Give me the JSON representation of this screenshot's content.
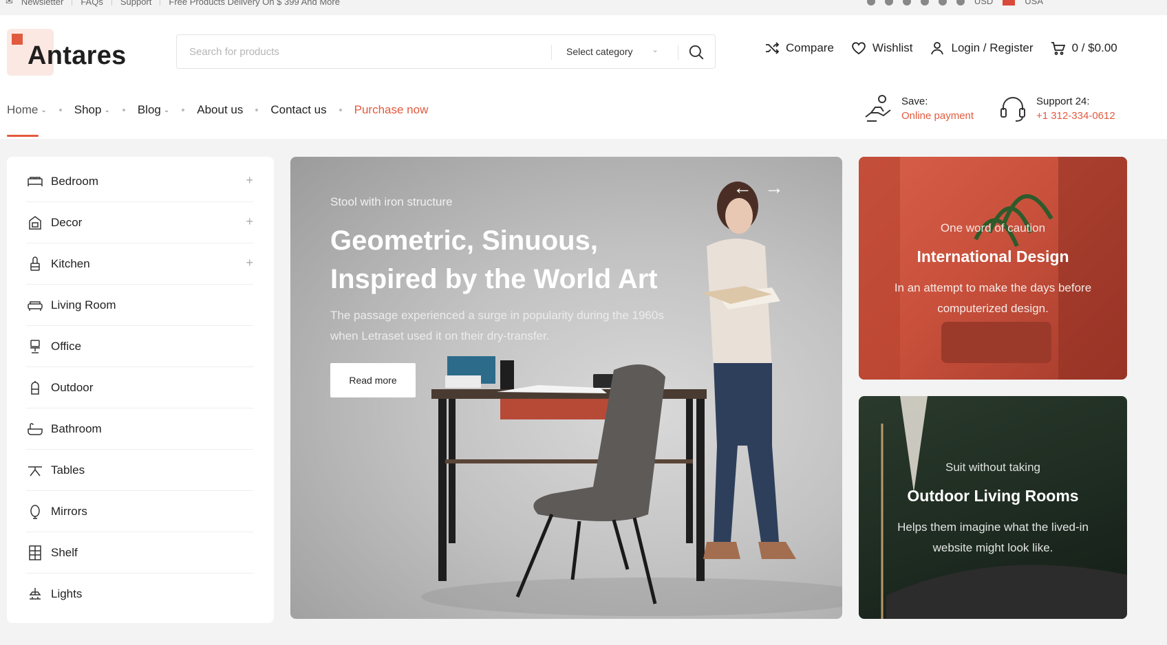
{
  "topbar": {
    "newsletter": "Newsletter",
    "faqs": "FAQs",
    "support": "Support",
    "promo": "Free Products Delivery On $ 399 And More",
    "currency": "USD",
    "country": "USA"
  },
  "brand": {
    "name": "Antares",
    "accent": "#e25a3e"
  },
  "search": {
    "placeholder": "Search for products",
    "category": "Select category"
  },
  "header_actions": {
    "compare": "Compare",
    "wishlist": "Wishlist",
    "login": "Login / Register",
    "cart": "0 / $0.00"
  },
  "nav": {
    "home": "Home",
    "shop": "Shop",
    "blog": "Blog",
    "about": "About us",
    "contact": "Contact us",
    "purchase": "Purchase now"
  },
  "info": {
    "save_label": "Save:",
    "save_value": "Online payment",
    "support_label": "Support 24:",
    "support_value": "+1 312-334-0612"
  },
  "categories": [
    {
      "label": "Bedroom",
      "icon": "bed-icon",
      "expandable": true
    },
    {
      "label": "Decor",
      "icon": "decor-icon",
      "expandable": true
    },
    {
      "label": "Kitchen",
      "icon": "kitchen-icon",
      "expandable": true
    },
    {
      "label": "Living Room",
      "icon": "sofa-icon",
      "expandable": false
    },
    {
      "label": "Office",
      "icon": "office-chair-icon",
      "expandable": false
    },
    {
      "label": "Outdoor",
      "icon": "outdoor-icon",
      "expandable": false
    },
    {
      "label": "Bathroom",
      "icon": "bathtub-icon",
      "expandable": false
    },
    {
      "label": "Tables",
      "icon": "table-icon",
      "expandable": false
    },
    {
      "label": "Mirrors",
      "icon": "mirror-icon",
      "expandable": false
    },
    {
      "label": "Shelf",
      "icon": "shelf-icon",
      "expandable": false
    },
    {
      "label": "Lights",
      "icon": "lamp-icon",
      "expandable": false
    }
  ],
  "hero": {
    "subtitle": "Stool with iron structure",
    "title": "Geometric, Sinuous, Inspired by the World Art",
    "description": "The passage experienced a surge in popularity during the 1960s when Letraset used it on their dry-transfer.",
    "button": "Read more"
  },
  "promos": [
    {
      "pre": "One word of caution",
      "title": "International Design",
      "text": "In an attempt to make the days before computerized design."
    },
    {
      "pre": "Suit without taking",
      "title": "Outdoor Living Rooms",
      "text": "Helps them imagine what the lived-in website might look like."
    }
  ]
}
